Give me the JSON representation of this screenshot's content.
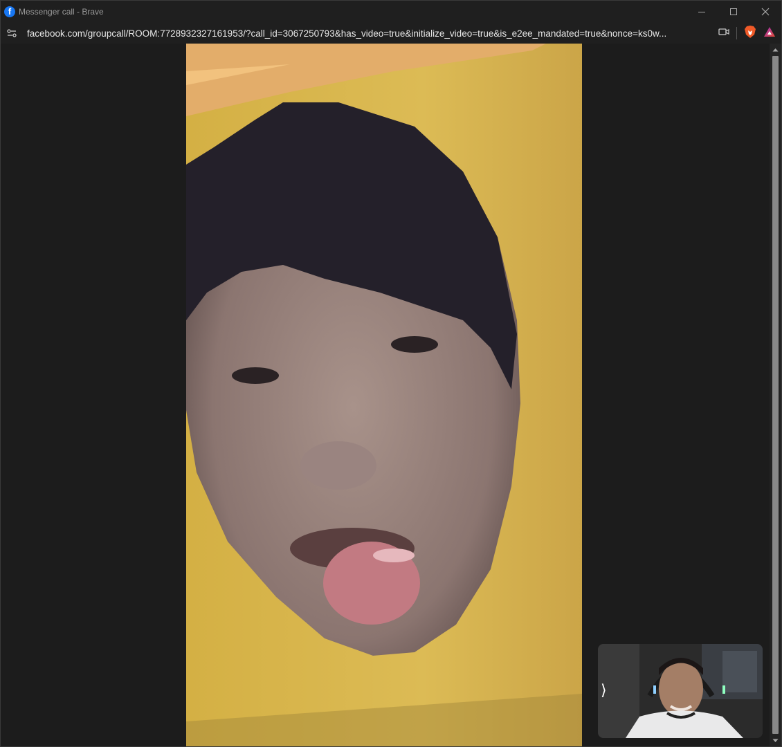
{
  "window": {
    "title": "Messenger call - Brave",
    "app_icon": "facebook-icon"
  },
  "address_bar": {
    "url": "facebook.com/groupcall/ROOM:7728932327161953/?call_id=3067250793&has_video=true&initialize_video=true&is_e2ee_mandated=true&nonce=ks0w..."
  },
  "self_view": {
    "expand_glyph": "⟩"
  },
  "colors": {
    "remote_background": "#d8b64a",
    "facebook_blue": "#1877f2",
    "brave_orange": "#f05a28"
  }
}
